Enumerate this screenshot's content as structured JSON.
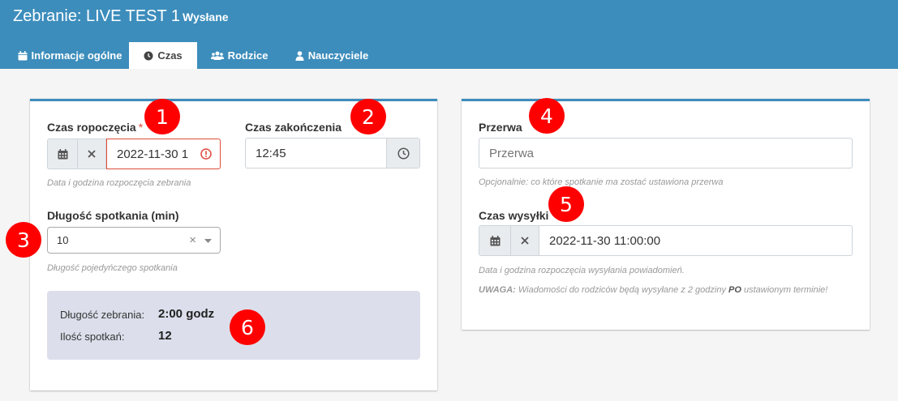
{
  "header": {
    "title": "Zebranie: LIVE TEST 1",
    "status": "Wysłane",
    "background": "#3c8dbc"
  },
  "tabs": [
    {
      "label": "Informacje ogólne",
      "icon": "calendar-icon",
      "active": false
    },
    {
      "label": "Czas",
      "icon": "clock-icon",
      "active": true
    },
    {
      "label": "Rodzice",
      "icon": "users-icon",
      "active": false
    },
    {
      "label": "Nauczyciele",
      "icon": "user-icon",
      "active": false
    }
  ],
  "time": {
    "start": {
      "label": "Czas ropoczęcia",
      "required_mark": "*",
      "value": "2022-11-30 1",
      "help": "Data i godzina rozpoczęcia zebrania"
    },
    "end": {
      "label": "Czas zakończenia",
      "value": "12:45"
    },
    "duration": {
      "label": "Długość spotkania (min)",
      "value": "10",
      "clear_glyph": "×",
      "help": "Długość pojedyńczego spotkania"
    },
    "summary": {
      "length_label": "Długość zebrania:",
      "length_value": "2:00 godz",
      "count_label": "Ilość spotkań:",
      "count_value": "12"
    }
  },
  "right": {
    "break": {
      "label": "Przerwa",
      "placeholder": "Przerwa",
      "help": "Opcjonalnie: co które spotkanie ma zostać ustawiona przerwa"
    },
    "send": {
      "label": "Czas wysyłki",
      "value": "2022-11-30 11:00:00",
      "help": "Data i godzina rozpoczęcia wysyłania powiadomień.",
      "warning_prefix": "UWAGA:",
      "warning_text1": " Wiadomości do rodziców będą wysyłane z 2 godziny ",
      "warning_bold": "PO",
      "warning_text2": " ustawionym terminie!"
    }
  },
  "markers": [
    "1",
    "2",
    "3",
    "4",
    "5",
    "6"
  ],
  "colors": {
    "accent": "#3c8dbc",
    "error": "#dd4b39",
    "marker": "#ff0000",
    "summary_bg": "#dcdfeb"
  }
}
